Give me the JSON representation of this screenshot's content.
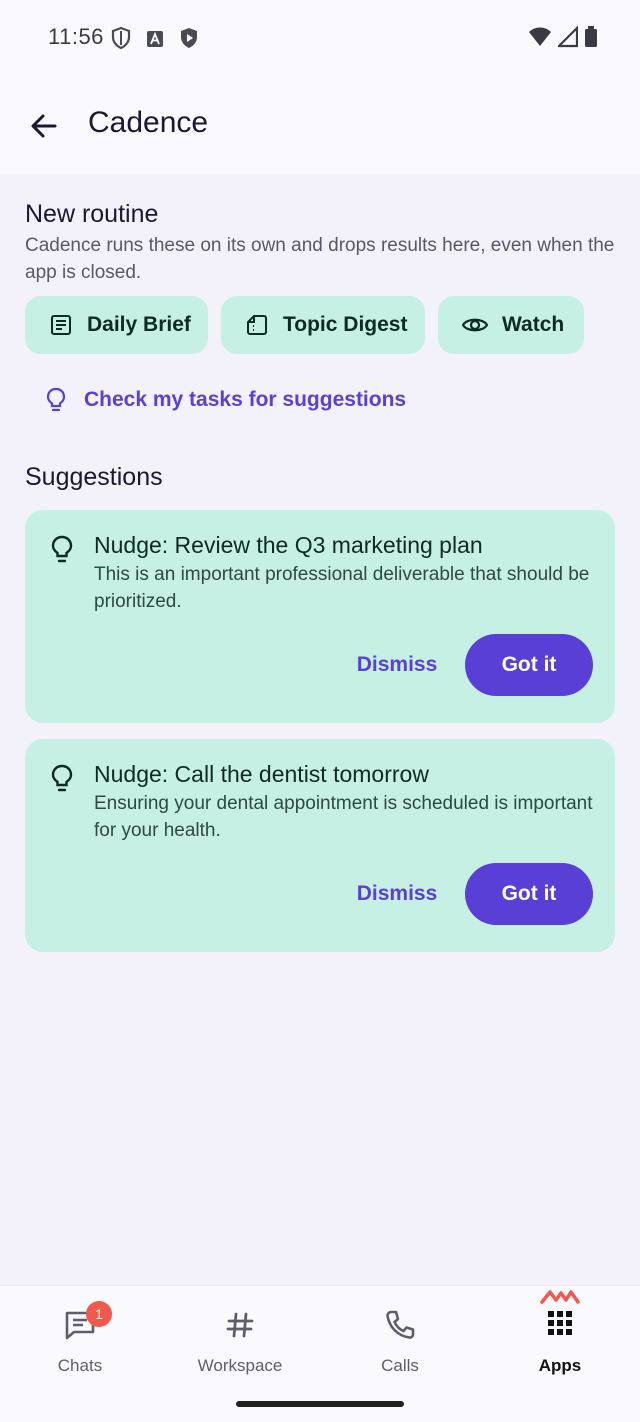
{
  "status": {
    "time": "11:56"
  },
  "appbar": {
    "title": "Cadence"
  },
  "routine": {
    "heading": "New routine",
    "description": "Cadence runs these on its own and drops results here, even when the app is closed.",
    "chips": [
      {
        "label": "Daily Brief",
        "icon": "article-icon"
      },
      {
        "label": "Topic Digest",
        "icon": "note-icon"
      },
      {
        "label": "Watch",
        "icon": "eye-icon"
      }
    ],
    "suggest_link": "Check my tasks for suggestions"
  },
  "suggestions": {
    "heading": "Suggestions",
    "items": [
      {
        "title": "Nudge: Review the Q3 marketing plan",
        "body": "This is an important professional deliverable that should be prioritized.",
        "dismiss": "Dismiss",
        "accept": "Got it"
      },
      {
        "title": "Nudge: Call the dentist tomorrow",
        "body": "Ensuring your dental appointment is scheduled is important for your health.",
        "dismiss": "Dismiss",
        "accept": "Got it"
      }
    ]
  },
  "nav": {
    "items": [
      {
        "label": "Chats",
        "badge": "1"
      },
      {
        "label": "Workspace"
      },
      {
        "label": "Calls"
      },
      {
        "label": "Apps",
        "active": true
      }
    ]
  },
  "colors": {
    "accent": "#5a3fd6",
    "chip_bg": "#c7f0e4",
    "badge": "#f1594d"
  }
}
